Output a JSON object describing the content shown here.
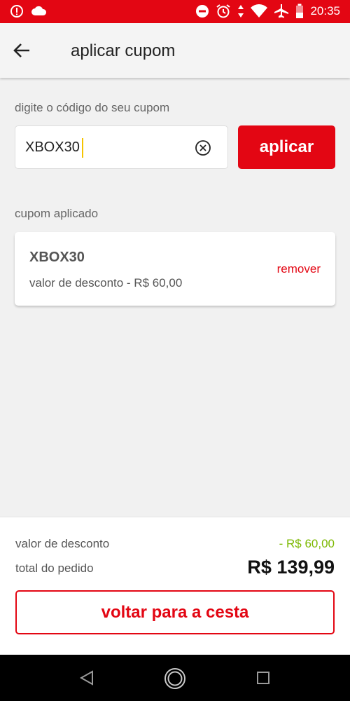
{
  "status_bar": {
    "time": "20:35",
    "left_icons": [
      "alert-icon",
      "cloud-icon"
    ],
    "right_icons": [
      "do-not-disturb-icon",
      "alarm-icon",
      "data-arrows-icon",
      "wifi-icon",
      "airplane-icon",
      "battery-icon"
    ],
    "color": "#e30613"
  },
  "app_bar": {
    "title": "aplicar cupom",
    "back_icon": "arrow-left-icon"
  },
  "coupon_form": {
    "prompt": "digite o código do seu cupom",
    "input_value": "XBOX30",
    "clear_icon": "clear-circle-icon",
    "apply_label": "aplicar"
  },
  "applied": {
    "section_label": "cupom aplicado",
    "code": "XBOX30",
    "discount_text": "valor de desconto - R$ 60,00",
    "remove_label": "remover"
  },
  "summary": {
    "discount_label": "valor de desconto",
    "discount_value": "- R$ 60,00",
    "total_label": "total do pedido",
    "total_value": "R$ 139,99",
    "back_to_basket_label": "voltar para a cesta"
  },
  "nav_bar": {
    "icons": [
      "back-triangle-icon",
      "home-circle-icon",
      "recents-square-icon"
    ]
  },
  "colors": {
    "brand_red": "#e30613",
    "discount_green": "#7cb800",
    "background": "#f1f1f1"
  }
}
